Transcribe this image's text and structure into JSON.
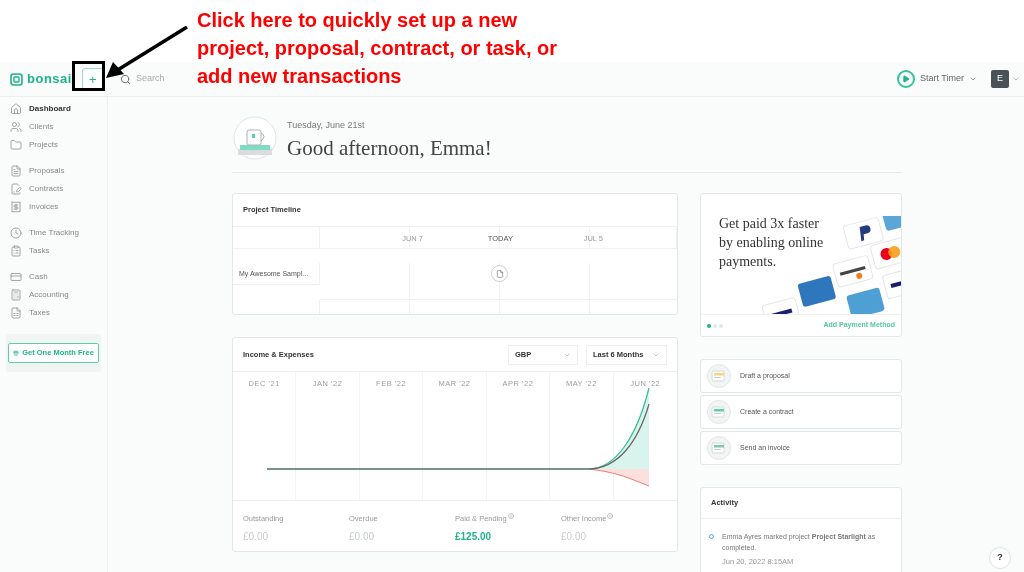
{
  "annotation": {
    "text": "Click here to quickly set up a new project, proposal, contract, or task, or add new transactions"
  },
  "header": {
    "logo": "bonsai",
    "add_button": "+",
    "search": {
      "placeholder": "Search"
    },
    "timer": "Start Timer",
    "avatar": "E"
  },
  "sidebar": {
    "sections": [
      {
        "items": [
          {
            "label": "Dashboard",
            "selected": true,
            "kind": "home"
          },
          {
            "label": "Clients",
            "selected": false,
            "kind": "clients"
          },
          {
            "label": "Projects",
            "selected": false,
            "kind": "folder"
          }
        ]
      },
      {
        "items": [
          {
            "label": "Proposals",
            "selected": false,
            "kind": "proposal"
          },
          {
            "label": "Contracts",
            "selected": false,
            "kind": "contract"
          },
          {
            "label": "Invoices",
            "selected": false,
            "kind": "invoice"
          }
        ]
      },
      {
        "items": [
          {
            "label": "Time Tracking",
            "selected": false,
            "kind": "clock"
          },
          {
            "label": "Tasks",
            "selected": false,
            "kind": "tasks"
          }
        ]
      },
      {
        "items": [
          {
            "label": "Cash",
            "selected": false,
            "kind": "cash"
          },
          {
            "label": "Accounting",
            "selected": false,
            "kind": "accounting"
          },
          {
            "label": "Taxes",
            "selected": false,
            "kind": "taxes"
          }
        ]
      }
    ],
    "promo": "Get One Month Free"
  },
  "greeting": {
    "date": "Tuesday, June 21st",
    "title": "Good afternoon, Emma!"
  },
  "timeline": {
    "title": "Project Timeline",
    "columns": [
      "JUN 7",
      "TODAY",
      "JUL 5"
    ],
    "rows": [
      {
        "name": "My Awesome Sampl..."
      }
    ]
  },
  "income": {
    "title": "Income & Expenses",
    "currency": "GBP",
    "range": "Last 6 Months",
    "months": [
      "DEC '21",
      "JAN '22",
      "FEB '22",
      "MAR '22",
      "APR '22",
      "MAY '22",
      "JUN '22"
    ],
    "stats": [
      {
        "label": "Outstanding",
        "value": "£0.00",
        "info": false,
        "highlight": false
      },
      {
        "label": "Overdue",
        "value": "£0.00",
        "info": false,
        "highlight": false
      },
      {
        "label": "Paid & Pending",
        "value": "£125.00",
        "info": true,
        "highlight": true
      },
      {
        "label": "Other Income",
        "value": "£0.00",
        "info": true,
        "highlight": false
      }
    ]
  },
  "payments": {
    "headline": "Get paid 3x faster by enabling online payments.",
    "link": "Add Payment Method",
    "dots": [
      {
        "selected": true
      },
      {
        "selected": false
      },
      {
        "selected": false
      }
    ]
  },
  "actions": [
    {
      "label": "Draft a proposal",
      "kind": "proposal"
    },
    {
      "label": "Create a contract",
      "kind": "contract"
    },
    {
      "label": "Send an invoice",
      "kind": "invoice"
    }
  ],
  "activity": {
    "title": "Activity",
    "items": [
      {
        "text": "Emma Ayres marked project **Project Starlight** as completed.",
        "time": "Jun 20, 2022 8:15AM"
      }
    ]
  },
  "help": "?"
}
